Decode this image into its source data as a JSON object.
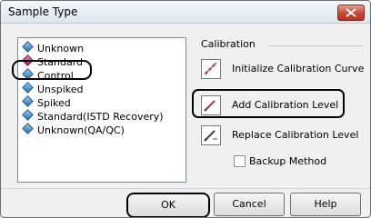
{
  "window": {
    "title": "Sample Type"
  },
  "sample_types": [
    "Unknown",
    "Standard",
    "Control",
    "Unspiked",
    "Spiked",
    "Standard(ISTD Recovery)",
    "Unknown(QA/QC)"
  ],
  "calibration": {
    "label": "Calibration",
    "options": [
      "Initialize Calibration Curve",
      "Add Calibration Level",
      "Replace Calibration Level"
    ],
    "backup_label": "Backup Method"
  },
  "buttons": {
    "ok": "OK",
    "cancel": "Cancel",
    "help": "Help"
  }
}
